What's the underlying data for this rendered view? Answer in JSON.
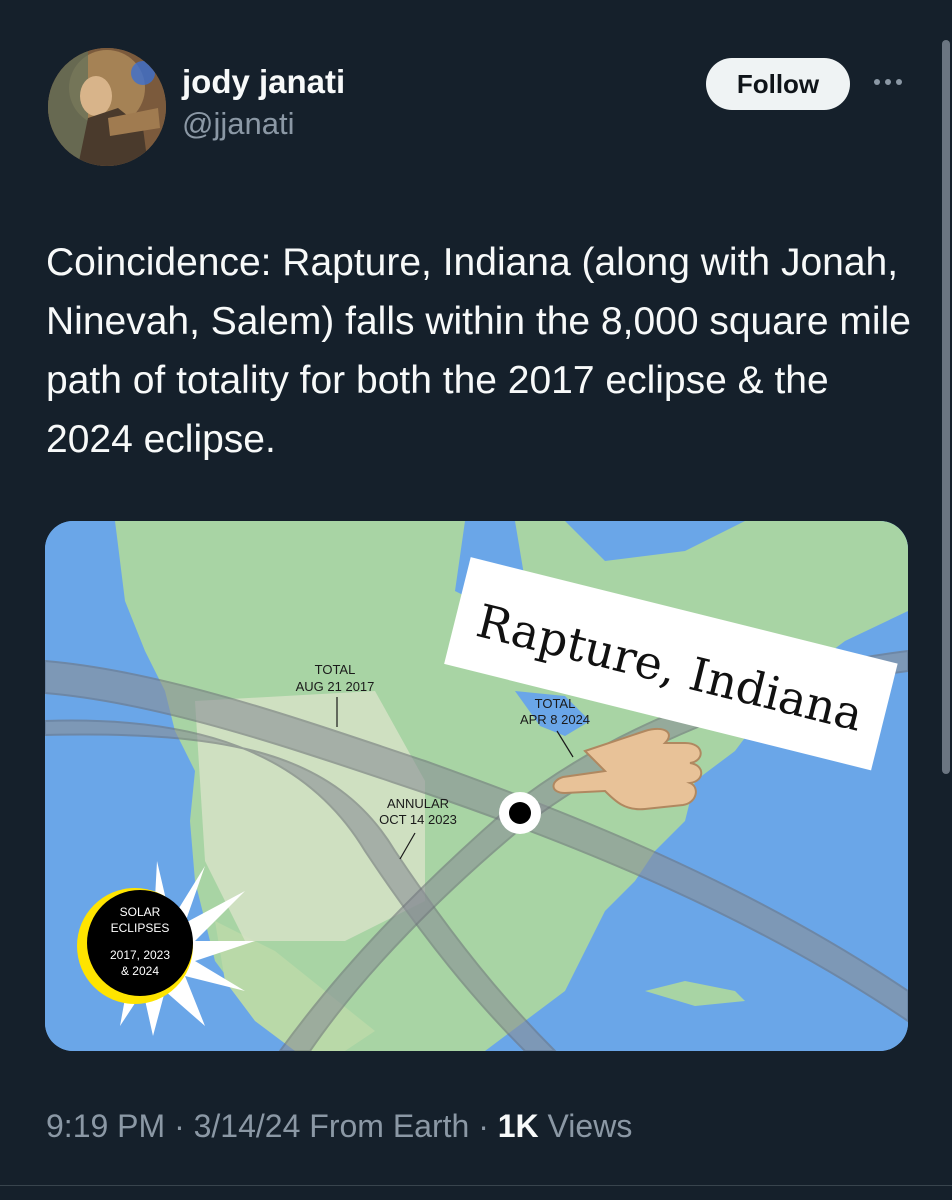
{
  "author": {
    "name": "jody janati",
    "handle": "@jjanati"
  },
  "follow_label": "Follow",
  "more_icon": "more-horizontal-icon",
  "tweet": {
    "text": "Coincidence: Rapture, Indiana (along with Jonah, Ninevah, Salem) falls within the 8,000 square mile path of totality for both the 2017 eclipse & the 2024 eclipse."
  },
  "map": {
    "overlay_label": "Rapture, Indiana",
    "path_2017": {
      "line1": "TOTAL",
      "line2": "AUG 21 2017"
    },
    "path_2024": {
      "line1": "TOTAL",
      "line2": "APR 8 2024"
    },
    "path_2023": {
      "line1": "ANNULAR",
      "line2": "OCT 14 2023"
    },
    "badge": {
      "line1": "SOLAR",
      "line2": "ECLIPSES",
      "line3": "2017, 2023",
      "line4": "& 2024"
    },
    "colors": {
      "ocean": "#6aa6e8",
      "land": "#a8d4a4",
      "path_band": "#8a8f96",
      "badge": "#ffe400"
    }
  },
  "meta": {
    "time": "9:19 PM",
    "date": "3/14/24",
    "source": "From Earth",
    "views_count": "1K",
    "views_label": "Views",
    "separator": "·"
  }
}
